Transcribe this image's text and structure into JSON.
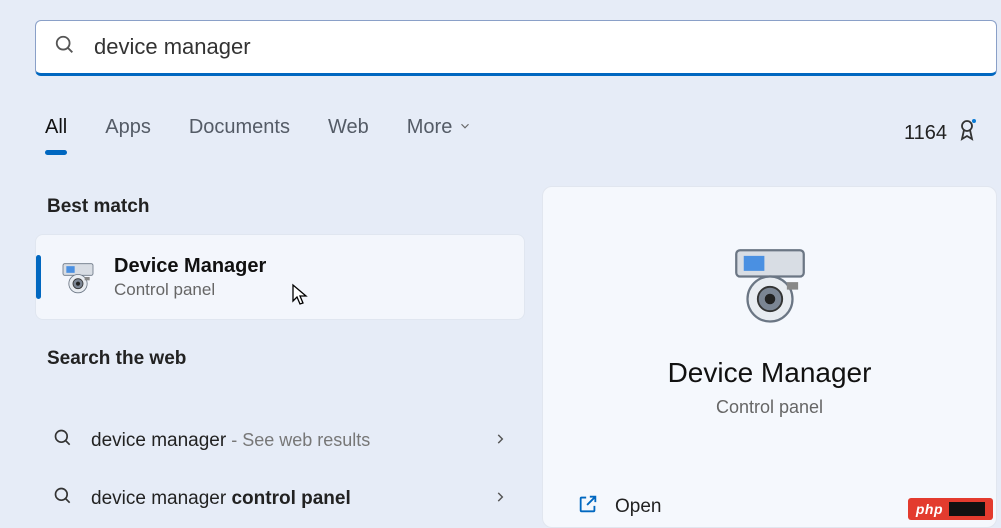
{
  "search": {
    "query": "device manager"
  },
  "tabs": {
    "all": "All",
    "apps": "Apps",
    "documents": "Documents",
    "web": "Web",
    "more": "More"
  },
  "rewards": {
    "points": "1164"
  },
  "sections": {
    "best_match": "Best match",
    "search_web": "Search the web"
  },
  "best": {
    "title": "Device Manager",
    "subtitle": "Control panel"
  },
  "web_results": [
    {
      "prefix": "device manager",
      "bold": "",
      "hint": " - See web results"
    },
    {
      "prefix": "device manager ",
      "bold": "control panel",
      "hint": ""
    }
  ],
  "preview": {
    "title": "Device Manager",
    "subtitle": "Control panel",
    "open": "Open"
  },
  "watermark": "php"
}
